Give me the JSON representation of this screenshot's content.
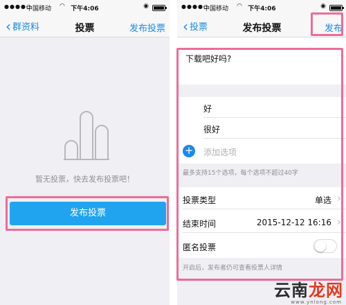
{
  "status": {
    "carrier": "中国移动",
    "time": "下午4:06"
  },
  "left_screen": {
    "nav": {
      "back_label": "群资料",
      "title": "投票",
      "action_label": "发布投票"
    },
    "empty_text": "暂无投票，快去发布投票吧！",
    "publish_button_label": "发布投票"
  },
  "right_screen": {
    "nav": {
      "back_label": "投票",
      "title": "发布投票",
      "action_label": "发布"
    },
    "question": "下载吧好吗?",
    "options": [
      "好",
      "很好"
    ],
    "add_option_placeholder": "添加选项",
    "limit_hint": "最多支持15个选项，每个选项不超过40字",
    "vote_type": {
      "label": "投票类型",
      "value": "单选"
    },
    "end_time": {
      "label": "结束时间",
      "value": "2015-12-12 16:16"
    },
    "anonymous": {
      "label": "匿名投票",
      "enabled": false
    },
    "footer_hint": "开启后，发布者仍可查看投票人详情"
  },
  "watermark": {
    "prefix": "云南",
    "accent": "龙网",
    "url": "www.ynlong.com"
  },
  "colors": {
    "accent": "#1a8ae6",
    "button": "#20a4ef",
    "highlight": "#ef6b96"
  }
}
